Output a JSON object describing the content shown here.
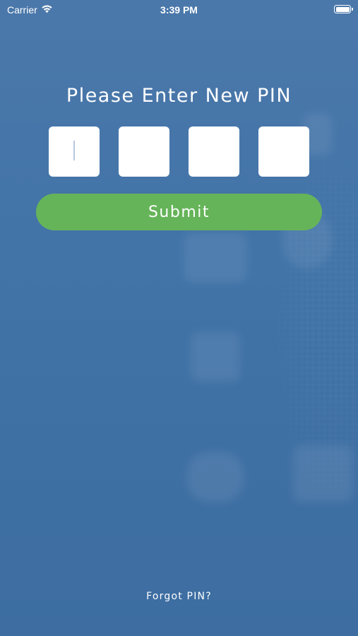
{
  "status_bar": {
    "carrier": "Carrier",
    "time": "3:39 PM",
    "icons": [
      "wifi-icon",
      "battery-icon"
    ]
  },
  "pin_screen": {
    "title": "Please Enter New PIN",
    "pin_fields": [
      {
        "value": ""
      },
      {
        "value": ""
      },
      {
        "value": ""
      },
      {
        "value": ""
      }
    ],
    "submit_label": "Submit",
    "forgot_label": "Forgot PIN?"
  },
  "colors": {
    "background": "#4274a8",
    "submit_button": "#66b459",
    "text": "#ffffff"
  }
}
